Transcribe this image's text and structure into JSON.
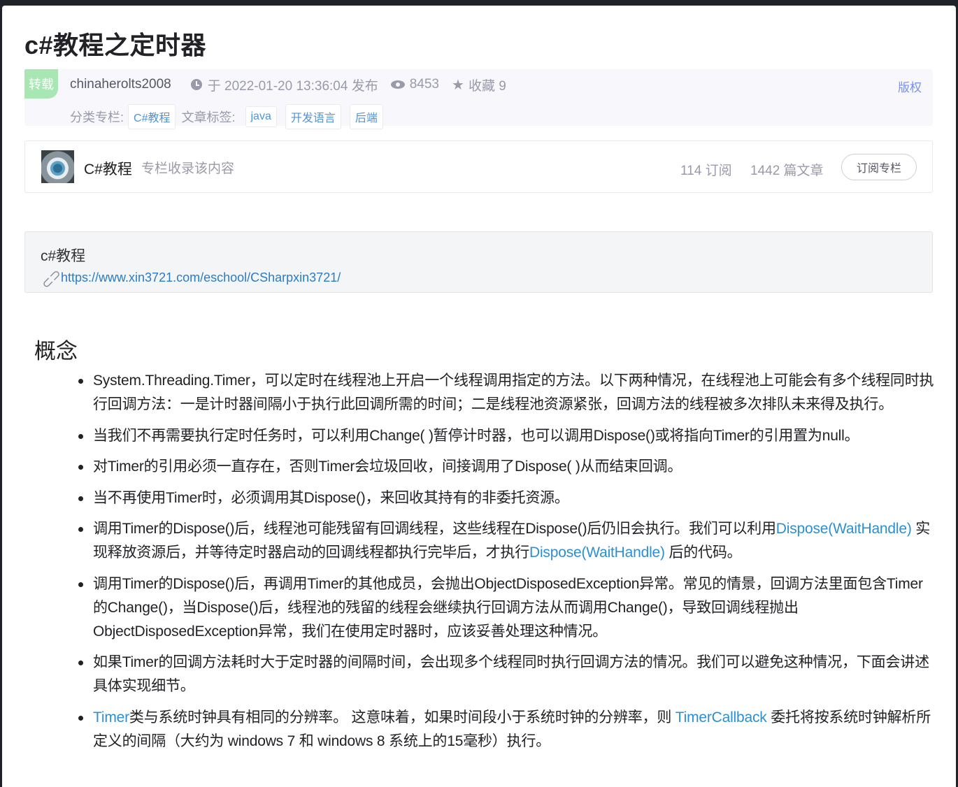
{
  "article": {
    "title": "c#教程之定时器",
    "repost_badge": "转载",
    "author": "chinaherolts2008",
    "published": "于 2022-01-20 13:36:04 发布",
    "views": "8453",
    "favorites": "收藏 9",
    "copyright": "版权",
    "category_label": "分类专栏:",
    "category_tags": [
      "C#教程"
    ],
    "tags_label": "文章标签:",
    "tags": [
      "java",
      "开发语言",
      "后端"
    ]
  },
  "column": {
    "name": "C#教程",
    "note": "专栏收录该内容",
    "subscribers": "114 订阅",
    "articles": "1442 篇文章",
    "subscribe_button": "订阅专栏"
  },
  "link_card": {
    "title": "c#教程",
    "url": "https://www.xin3721.com/eschool/CSharpxin3721/"
  },
  "content": {
    "section_title": "概念",
    "bullets": [
      {
        "parts": [
          {
            "text": "System.Threading.Timer，可以定时在线程池上开启一个线程调用指定的方法。以下两种情况，在线程池上可能会有多个线程同时执行回调方法：一是计时器间隔小于执行此回调所需的时间；二是线程池资源紧张，回调方法的线程被多次排队未来得及执行。"
          }
        ]
      },
      {
        "parts": [
          {
            "text": "当我们不再需要执行定时任务时，可以利用Change( )暂停计时器，也可以调用Dispose()或将指向Timer的引用置为null。"
          }
        ]
      },
      {
        "parts": [
          {
            "text": "对Timer的引用必须一直存在，否则Timer会垃圾回收，间接调用了Dispose( )从而结束回调。"
          }
        ]
      },
      {
        "parts": [
          {
            "text": "当不再使用Timer时，必须调用其Dispose()，来回收其持有的非委托资源。"
          }
        ]
      },
      {
        "parts": [
          {
            "text": "调用Timer的Dispose()后，线程池可能残留有回调线程，这些线程在Dispose()后仍旧会执行。我们可以利用"
          },
          {
            "text": "Dispose(WaitHandle)",
            "link": true
          },
          {
            "text": " 实现释放资源后，并等待定时器启动的回调线程都执行完毕后，才执行"
          },
          {
            "text": "Dispose(WaitHandle)",
            "link": true
          },
          {
            "text": " 后的代码。"
          }
        ]
      },
      {
        "parts": [
          {
            "text": "调用Timer的Dispose()后，再调用Timer的其他成员，会抛出ObjectDisposedException异常。常见的情景，回调方法里面包含Timer的Change()，当Dispose()后，线程池的残留的线程会继续执行回调方法从而调用Change()，导致回调线程抛出ObjectDisposedException异常，我们在使用定时器时，应该妥善处理这种情况。"
          }
        ]
      },
      {
        "parts": [
          {
            "text": "如果Timer的回调方法耗时大于定时器的间隔时间，会出现多个线程同时执行回调方法的情况。我们可以避免这种情况，下面会讲述具体实现细节。"
          }
        ]
      },
      {
        "parts": [
          {
            "text": "Timer",
            "link": true
          },
          {
            "text": "类与系统时钟具有相同的分辨率。 这意味着，如果时间段小于系统时钟的分辨率，则 "
          },
          {
            "text": "TimerCallback",
            "link": true
          },
          {
            "text": " 委托将按系统时钟解析所定义的间隔（大约为 windows 7 和 windows 8 系统上的15毫秒）执行。"
          }
        ]
      }
    ]
  }
}
